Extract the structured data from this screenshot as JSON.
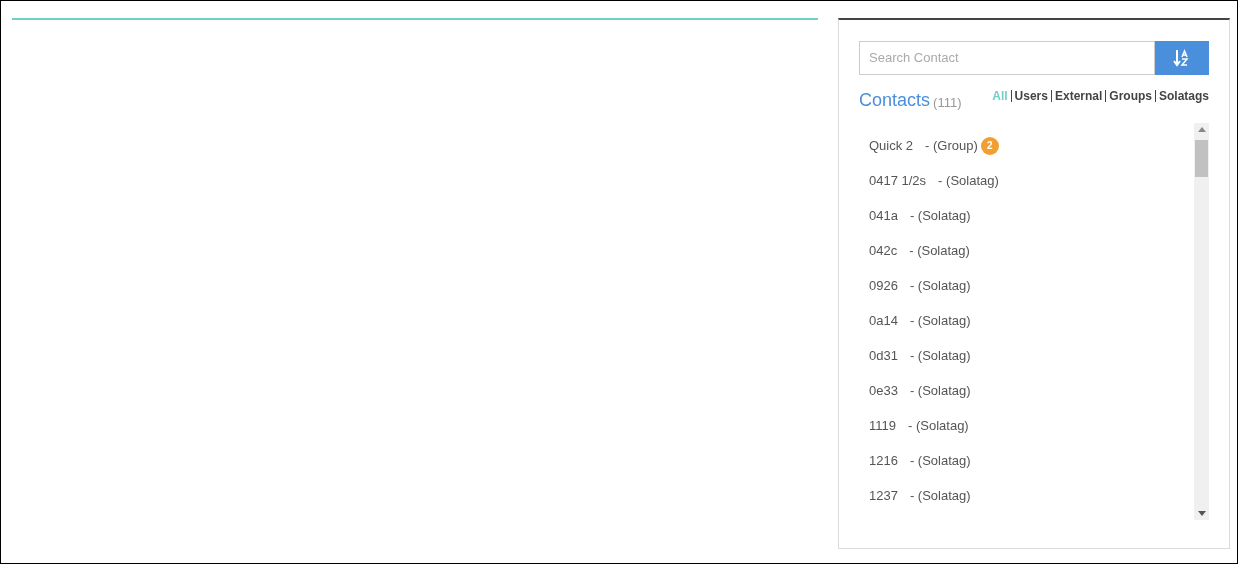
{
  "search": {
    "placeholder": "Search Contact"
  },
  "contacts_header": {
    "title": "Contacts",
    "count": "(111)"
  },
  "filters": [
    {
      "label": "All",
      "selected": true
    },
    {
      "label": "Users",
      "selected": false
    },
    {
      "label": "External",
      "selected": false
    },
    {
      "label": "Groups",
      "selected": false
    },
    {
      "label": "Solatags",
      "selected": false
    }
  ],
  "contacts": [
    {
      "name": "Quick 2",
      "type": "- (Group)",
      "badge": "2"
    },
    {
      "name": "0417 1/2s",
      "type": "- (Solatag)"
    },
    {
      "name": "041a",
      "type": "- (Solatag)"
    },
    {
      "name": "042c",
      "type": "- (Solatag)"
    },
    {
      "name": "0926",
      "type": "- (Solatag)"
    },
    {
      "name": "0a14",
      "type": "- (Solatag)"
    },
    {
      "name": "0d31",
      "type": "- (Solatag)"
    },
    {
      "name": "0e33",
      "type": "- (Solatag)"
    },
    {
      "name": "1119",
      "type": "- (Solatag)"
    },
    {
      "name": "1216",
      "type": "- (Solatag)"
    },
    {
      "name": "1237",
      "type": "- (Solatag)"
    }
  ]
}
